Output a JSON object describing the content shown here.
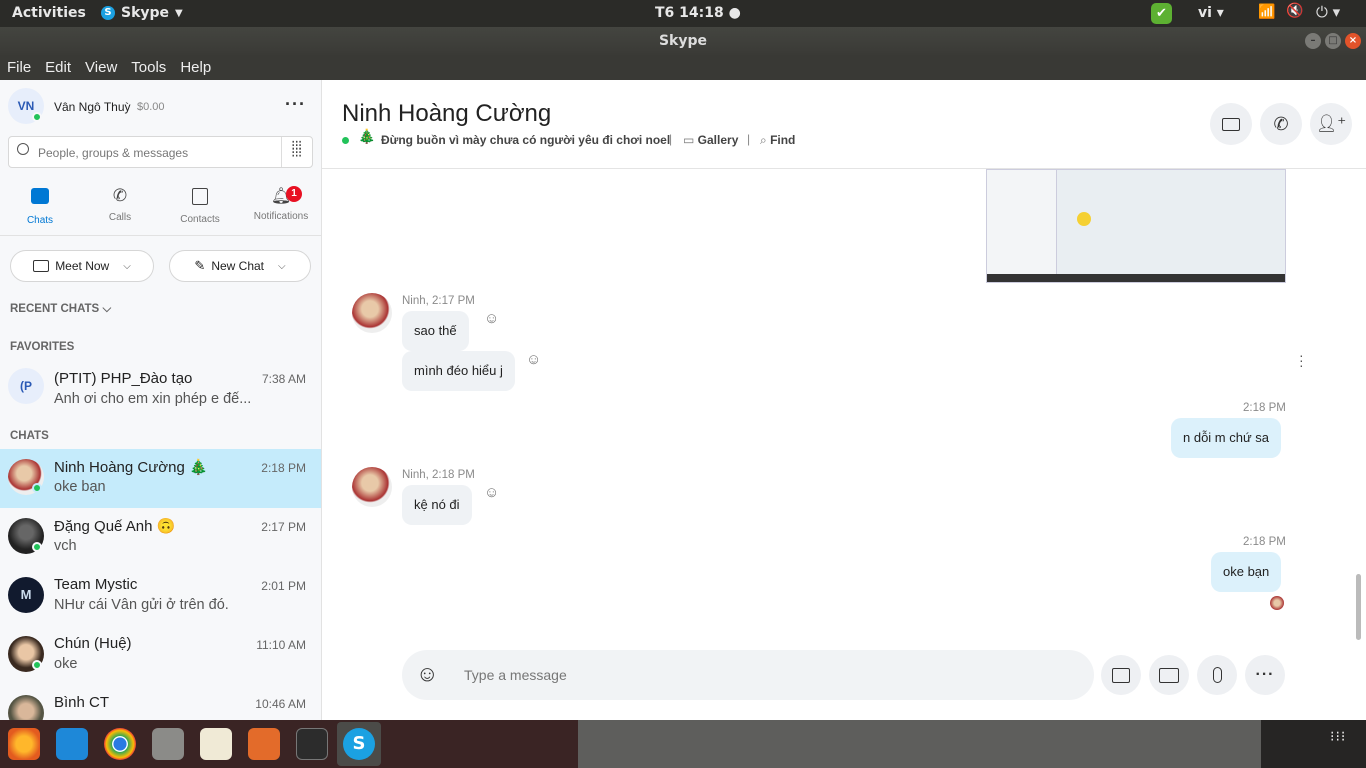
{
  "topbar": {
    "activities": "Activities",
    "app": "Skype",
    "clock": "T6 14:18",
    "lang": "vi"
  },
  "window": {
    "title": "Skype"
  },
  "menu": [
    "File",
    "Edit",
    "View",
    "Tools",
    "Help"
  ],
  "profile": {
    "initials": "VN",
    "name": "Vân Ngô Thuỳ",
    "balance": "$0.00"
  },
  "search": {
    "placeholder": "People, groups & messages"
  },
  "nav": {
    "chats": "Chats",
    "calls": "Calls",
    "contacts": "Contacts",
    "notifications": "Notifications",
    "badge": "1"
  },
  "actions": {
    "meet_now": "Meet Now",
    "new_chat": "New Chat"
  },
  "sections": {
    "recent": "RECENT CHATS",
    "favorites": "FAVORITES",
    "chats": "CHATS"
  },
  "favorites": [
    {
      "initials": "(P",
      "name": "(PTIT) PHP_Đào tạo",
      "time": "7:38 AM",
      "preview": "Anh ơi cho em xin phép e đế..."
    }
  ],
  "chats": [
    {
      "name": "Ninh Hoàng Cường 🎄",
      "time": "2:18 PM",
      "preview": "oke bạn"
    },
    {
      "name": "Đặng Quế Anh 🙃",
      "time": "2:17 PM",
      "preview": "vch"
    },
    {
      "name": "Team Mystic",
      "time": "2:01 PM",
      "preview": "NHư cái Vân gửi ở trên đó."
    },
    {
      "name": "Chún (Huệ)",
      "time": "11:10 AM",
      "preview": "oke"
    },
    {
      "name": "Bình CT",
      "time": "10:46 AM",
      "preview": ""
    }
  ],
  "conversation": {
    "title": "Ninh Hoàng Cường",
    "mood": "Đừng buồn vì mày chưa có người yêu đi chơi noel",
    "gallery": "Gallery",
    "find": "Find"
  },
  "messages": {
    "m1_meta": "Ninh, 2:17 PM",
    "m1": "sao thế",
    "m2": "mình đéo hiểu j",
    "m3_time": "2:18 PM",
    "m3": "n dỗi m chứ sa",
    "m4_meta": "Ninh, 2:18 PM",
    "m4": "kệ nó đi",
    "m5_time": "2:18 PM",
    "m5": "oke bạn"
  },
  "composer": {
    "placeholder": "Type a message"
  },
  "colors": {
    "accent": "#0078d4",
    "selected": "#c5ebfb",
    "online": "#22c25a"
  }
}
